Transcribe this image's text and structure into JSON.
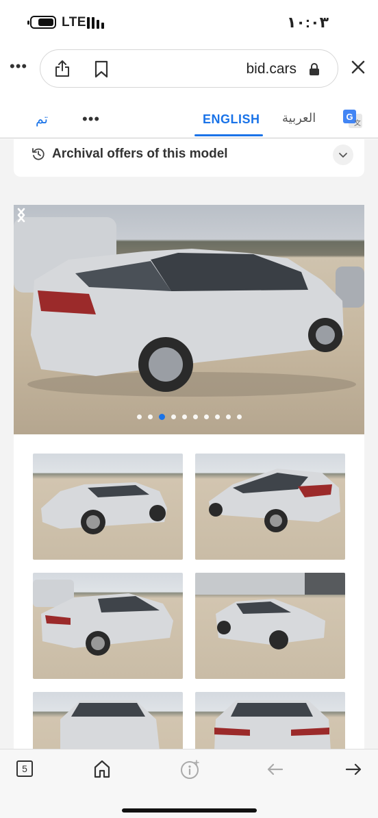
{
  "status_bar": {
    "network": "LTE",
    "time": "١٠:٠٣"
  },
  "address_bar": {
    "url": "bid.cars"
  },
  "translate_bar": {
    "done_label": "تم",
    "tab_english": "ENGLISH",
    "tab_arabic": "العربية"
  },
  "page": {
    "archival_label": "Archival offers of this model",
    "gallery": {
      "dot_count": 10,
      "active_dot": 2
    }
  },
  "toolbar": {
    "tab_count": "5"
  },
  "colors": {
    "accent": "#1a73e8",
    "car_silver": "#d6d8db"
  }
}
